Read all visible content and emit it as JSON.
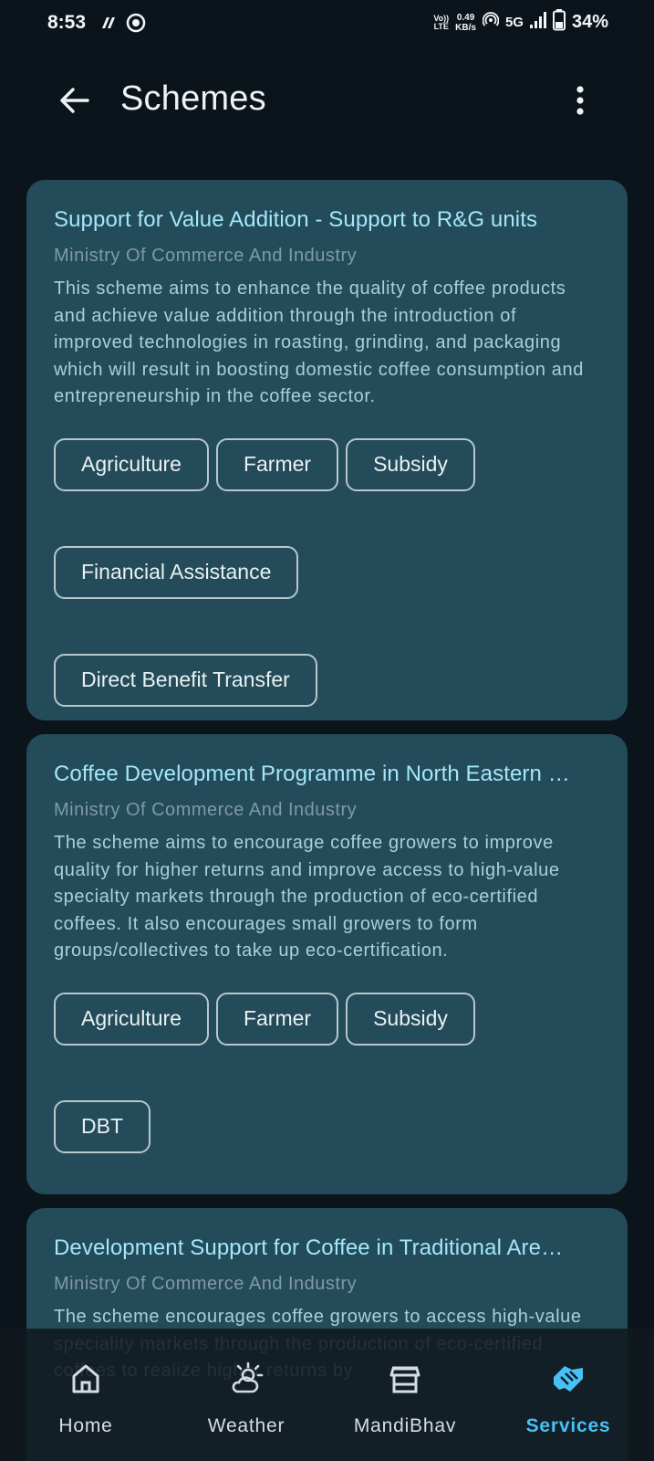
{
  "status_bar": {
    "time": "8:53",
    "volte_top": "Vo)) ",
    "volte_bottom": "LTE",
    "speed_value": "0.49",
    "speed_unit": "KB/s",
    "network": "5G",
    "battery": "34%"
  },
  "app_bar": {
    "title": "Schemes"
  },
  "schemes": [
    {
      "title": "Support for Value Addition - Support to R&G units",
      "ministry": "Ministry Of Commerce And Industry",
      "description": "This scheme aims to enhance the quality of coffee products and achieve value addition through the introduction of improved technologies in roasting, grinding, and packaging which will result in boosting domestic coffee consumption and entrepreneurship in the coffee sector.",
      "tags": [
        "Agriculture",
        "Farmer",
        "Subsidy",
        "Financial Assistance",
        "Direct Benefit Transfer"
      ]
    },
    {
      "title": "Coffee Development Programme in North Eastern …",
      "ministry": "Ministry Of Commerce And Industry",
      "description": "The scheme aims to encourage coffee growers to improve quality for higher returns and improve access to high-value specialty markets through the production of eco-certified coffees. It also encourages small growers to form groups/collectives to take up eco-certification.",
      "tags": [
        "Agriculture",
        "Farmer",
        "Subsidy",
        "DBT"
      ]
    },
    {
      "title": "Development Support for Coffee in Traditional Are…",
      "ministry": "Ministry Of Commerce And Industry",
      "description": "The scheme encourages coffee growers to access high-value speciality markets through the production of eco-certified coffees to realize higher returns by"
    }
  ],
  "bottom_nav": {
    "items": [
      {
        "label": "Home",
        "icon": "home-icon"
      },
      {
        "label": "Weather",
        "icon": "weather-icon"
      },
      {
        "label": "MandiBhav",
        "icon": "store-icon"
      },
      {
        "label": "Services",
        "icon": "services-icon"
      }
    ],
    "active": "Services",
    "active_color": "#46c0f5"
  },
  "colors": {
    "background": "#0c141b",
    "card": "#244b59",
    "title": "#a3e7fb",
    "accent": "#46c0f5"
  }
}
